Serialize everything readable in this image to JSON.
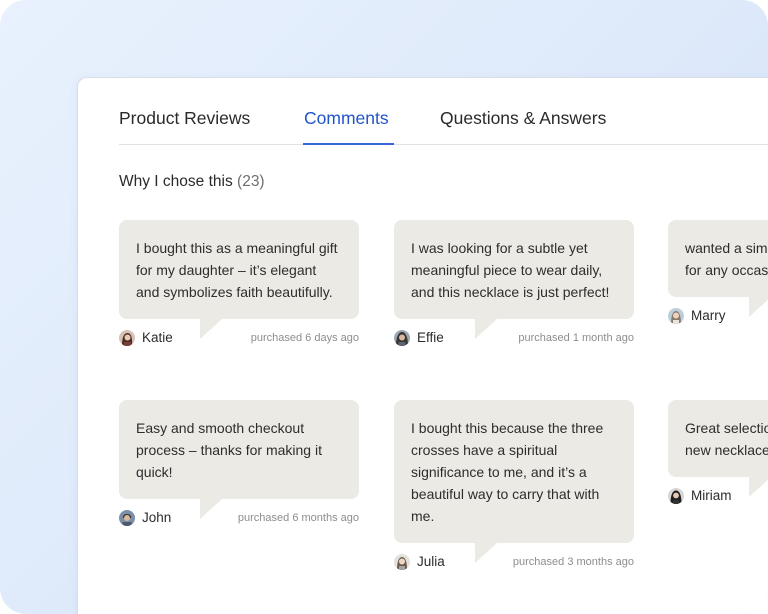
{
  "tabs": [
    {
      "label": "Product Reviews",
      "active": false
    },
    {
      "label": "Comments",
      "active": true
    },
    {
      "label": "Questions & Answers",
      "active": false
    }
  ],
  "section": {
    "title": "Why I chose this",
    "count": "(23)"
  },
  "comments": [
    {
      "text": "I bought this as a meaningful gift for my daughter – it’s elegant and symbolizes faith beautifully.",
      "name": "Katie",
      "purchased": "purchased 6 days ago"
    },
    {
      "text": "I was looking for a subtle yet meaningful piece to wear daily, and this necklace is just perfect!",
      "name": "Effie",
      "purchased": "purchased 1 month ago"
    },
    {
      "text": "wanted a simple gold necklace for any occasion, design caught",
      "name": "Marry",
      "purchased": ""
    },
    {
      "text": "Easy and smooth checkout process – thanks for making it quick!",
      "name": "John",
      "purchased": "purchased 6 months ago"
    },
    {
      "text": "I bought this because the three crosses have a spiritual significance to me, and it’s a beautiful way to carry that with me.",
      "name": "Julia",
      "purchased": "purchased 3 months ago"
    },
    {
      "text": "Great selection, checkout. Can new necklace",
      "name": "Miriam",
      "purchased": ""
    }
  ],
  "colors": {
    "accent": "#2154c9",
    "bubble": "#eceae4",
    "background": "#e3eefb"
  }
}
